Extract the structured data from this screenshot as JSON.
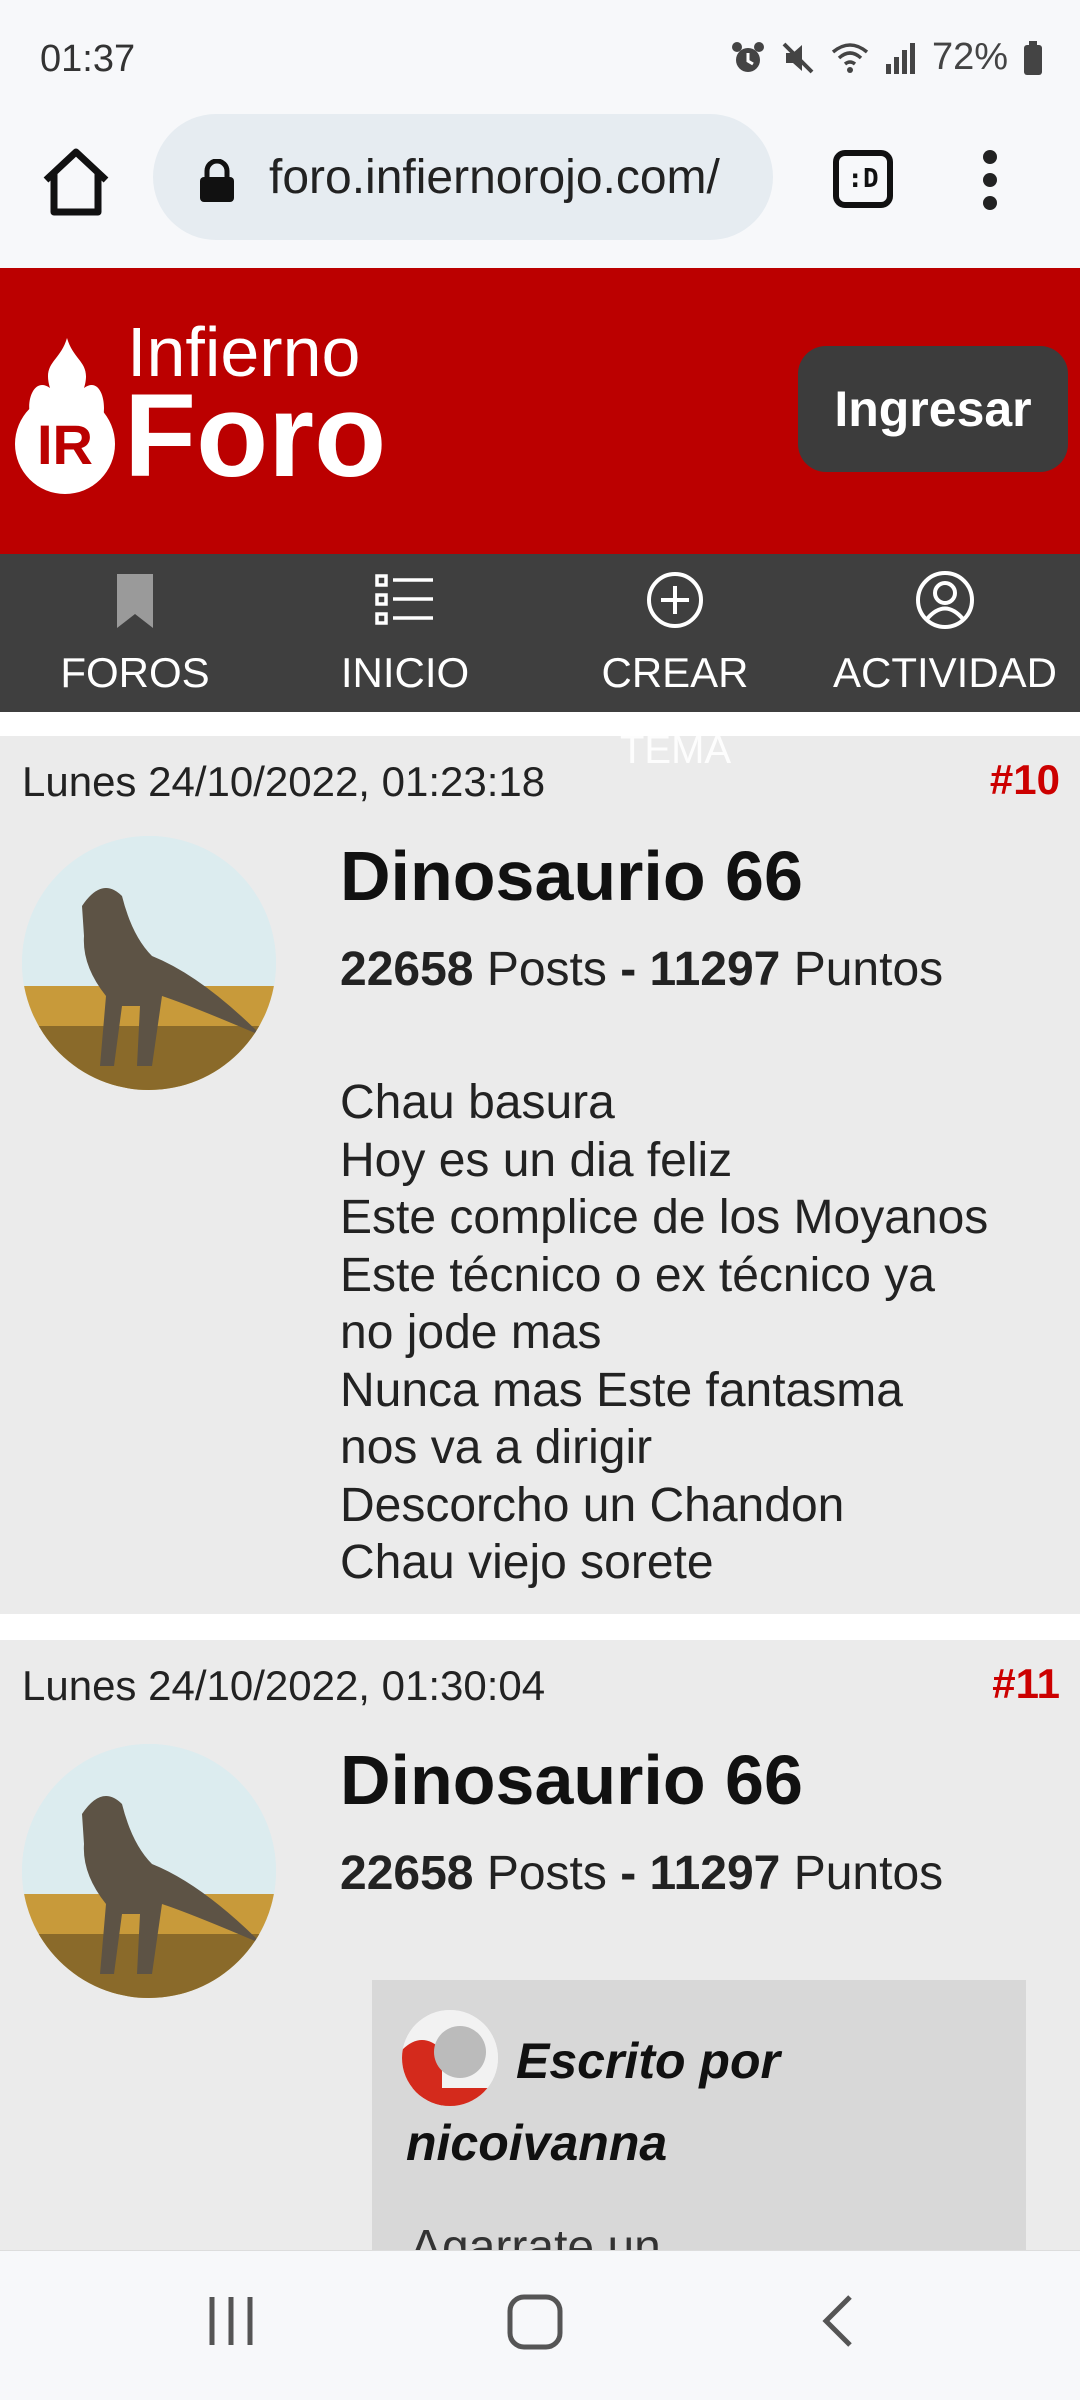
{
  "status_bar": {
    "time": "01:37",
    "battery": "72%"
  },
  "browser": {
    "url": "foro.infiernorojo.com/",
    "tab_label": ":D"
  },
  "header": {
    "logo_line1": "Infierno",
    "logo_line2": "Foro",
    "logo_badge": "IR",
    "login_label": "Ingresar"
  },
  "nav": {
    "items": [
      {
        "label": "FOROS",
        "icon": "bookmark-icon"
      },
      {
        "label": "INICIO",
        "icon": "list-icon"
      },
      {
        "label": "CREAR",
        "icon": "plus-circle-icon"
      },
      {
        "label": "ACTIVIDAD",
        "icon": "user-circle-icon"
      }
    ],
    "crear_overflow": "TEMA"
  },
  "posts": [
    {
      "date": "Lunes 24/10/2022, 01:23:18",
      "number": "#10",
      "author": "Dinosaurio 66",
      "posts_count": "22658",
      "posts_label": "Posts",
      "separator": "-",
      "points_count": "11297",
      "points_label": "Puntos",
      "lines": [
        "Chau basura",
        "Hoy es un dia feliz",
        "Este complice de los Moyanos",
        "Este técnico o ex técnico ya",
        "no jode mas",
        "Nunca mas Este fantasma",
        "nos va a dirigir",
        "Descorcho un Chandon",
        "Chau viejo sorete"
      ]
    },
    {
      "date": "Lunes 24/10/2022, 01:30:04",
      "number": "#11",
      "author": "Dinosaurio 66",
      "posts_count": "22658",
      "posts_label": "Posts",
      "separator": "-",
      "points_count": "11297",
      "points_label": "Puntos",
      "quote": {
        "title": "Escrito por nicoivanna",
        "text": "Agarrate un"
      }
    }
  ],
  "colors": {
    "brand_red": "#bb0000",
    "nav_dark": "#3f3f3f",
    "post_bg": "#ebebeb",
    "post_number": "#cc0000"
  }
}
